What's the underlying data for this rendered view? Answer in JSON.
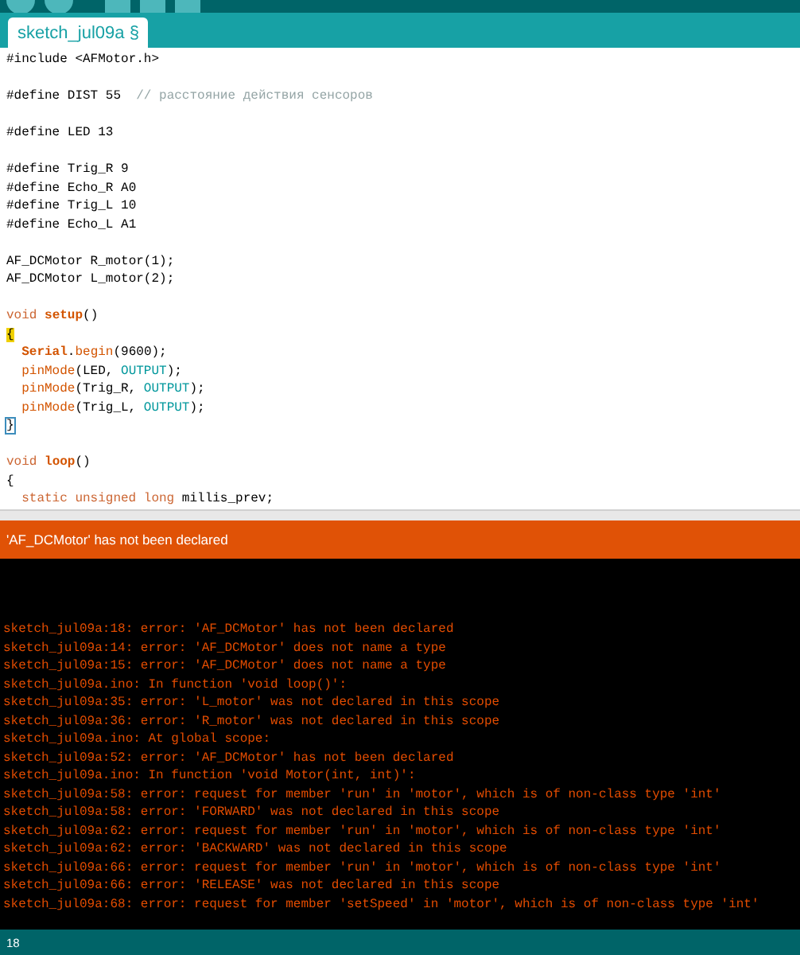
{
  "tab": {
    "label": "sketch_jul09a §",
    "selected": true
  },
  "editor": {
    "lines": [
      {
        "kind": "code",
        "tokens": [
          {
            "kind": "text",
            "text": "#include <AFMotor.h>"
          }
        ]
      },
      {
        "kind": "blank"
      },
      {
        "kind": "code",
        "tokens": [
          {
            "kind": "text",
            "text": "#define DIST 55  "
          },
          {
            "kind": "comment",
            "text": "// расстояние действия сенсоров"
          }
        ]
      },
      {
        "kind": "blank"
      },
      {
        "kind": "code",
        "tokens": [
          {
            "kind": "text",
            "text": "#define LED 13"
          }
        ]
      },
      {
        "kind": "blank"
      },
      {
        "kind": "code",
        "tokens": [
          {
            "kind": "text",
            "text": "#define Trig_R 9"
          }
        ]
      },
      {
        "kind": "code",
        "tokens": [
          {
            "kind": "text",
            "text": "#define Echo_R A0"
          }
        ]
      },
      {
        "kind": "code",
        "tokens": [
          {
            "kind": "text",
            "text": "#define Trig_L 10"
          }
        ]
      },
      {
        "kind": "code",
        "tokens": [
          {
            "kind": "text",
            "text": "#define Echo_L A1"
          }
        ]
      },
      {
        "kind": "blank"
      },
      {
        "kind": "code",
        "tokens": [
          {
            "kind": "text",
            "text": "AF_DCMotor R_motor(1);"
          }
        ]
      },
      {
        "kind": "code",
        "tokens": [
          {
            "kind": "text",
            "text": "AF_DCMotor L_motor(2);"
          }
        ]
      },
      {
        "kind": "blank"
      },
      {
        "kind": "code",
        "tokens": [
          {
            "kind": "keyword",
            "text": "void "
          },
          {
            "kind": "function",
            "text": "setup"
          },
          {
            "kind": "text",
            "text": "()"
          }
        ]
      },
      {
        "kind": "code",
        "tokens": [
          {
            "kind": "match",
            "text": "{"
          }
        ]
      },
      {
        "kind": "code",
        "indent": true,
        "tokens": [
          {
            "kind": "class",
            "text": "Serial"
          },
          {
            "kind": "text",
            "text": "."
          },
          {
            "kind": "builtin",
            "text": "begin"
          },
          {
            "kind": "text",
            "text": "(9600);"
          }
        ]
      },
      {
        "kind": "code",
        "indent": true,
        "tokens": [
          {
            "kind": "builtin",
            "text": "pinMode"
          },
          {
            "kind": "text",
            "text": "(LED, "
          },
          {
            "kind": "constant",
            "text": "OUTPUT"
          },
          {
            "kind": "text",
            "text": ");"
          }
        ]
      },
      {
        "kind": "code",
        "indent": true,
        "tokens": [
          {
            "kind": "builtin",
            "text": "pinMode"
          },
          {
            "kind": "text",
            "text": "(Trig_R, "
          },
          {
            "kind": "constant",
            "text": "OUTPUT"
          },
          {
            "kind": "text",
            "text": ");"
          }
        ]
      },
      {
        "kind": "code",
        "indent": true,
        "tokens": [
          {
            "kind": "builtin",
            "text": "pinMode"
          },
          {
            "kind": "text",
            "text": "(Trig_L, "
          },
          {
            "kind": "constant",
            "text": "OUTPUT"
          },
          {
            "kind": "text",
            "text": ");"
          }
        ]
      },
      {
        "kind": "code",
        "tokens": [
          {
            "kind": "boxed",
            "text": "}"
          }
        ]
      },
      {
        "kind": "blank"
      },
      {
        "kind": "code",
        "tokens": [
          {
            "kind": "keyword",
            "text": "void "
          },
          {
            "kind": "function",
            "text": "loop"
          },
          {
            "kind": "text",
            "text": "()"
          }
        ]
      },
      {
        "kind": "code",
        "tokens": [
          {
            "kind": "text",
            "text": "{"
          }
        ]
      },
      {
        "kind": "code",
        "indent": true,
        "tokens": [
          {
            "kind": "keyword",
            "text": "static unsigned long"
          },
          {
            "kind": "text",
            "text": " millis_prev;"
          }
        ]
      }
    ]
  },
  "message_bar": {
    "text": "'AF_DCMotor' has not been declared"
  },
  "console": {
    "lines": [
      "sketch_jul09a:18: error: 'AF_DCMotor' has not been declared",
      "sketch_jul09a:14: error: 'AF_DCMotor' does not name a type",
      "sketch_jul09a:15: error: 'AF_DCMotor' does not name a type",
      "sketch_jul09a.ino: In function 'void loop()':",
      "sketch_jul09a:35: error: 'L_motor' was not declared in this scope",
      "sketch_jul09a:36: error: 'R_motor' was not declared in this scope",
      "sketch_jul09a.ino: At global scope:",
      "sketch_jul09a:52: error: 'AF_DCMotor' has not been declared",
      "sketch_jul09a.ino: In function 'void Motor(int, int)':",
      "sketch_jul09a:58: error: request for member 'run' in 'motor', which is of non-class type 'int'",
      "sketch_jul09a:58: error: 'FORWARD' was not declared in this scope",
      "sketch_jul09a:62: error: request for member 'run' in 'motor', which is of non-class type 'int'",
      "sketch_jul09a:62: error: 'BACKWARD' was not declared in this scope",
      "sketch_jul09a:66: error: request for member 'run' in 'motor', which is of non-class type 'int'",
      "sketch_jul09a:66: error: 'RELEASE' was not declared in this scope",
      "sketch_jul09a:68: error: request for member 'setSpeed' in 'motor', which is of non-class type 'int'"
    ]
  },
  "status_bar": {
    "line": "18"
  }
}
